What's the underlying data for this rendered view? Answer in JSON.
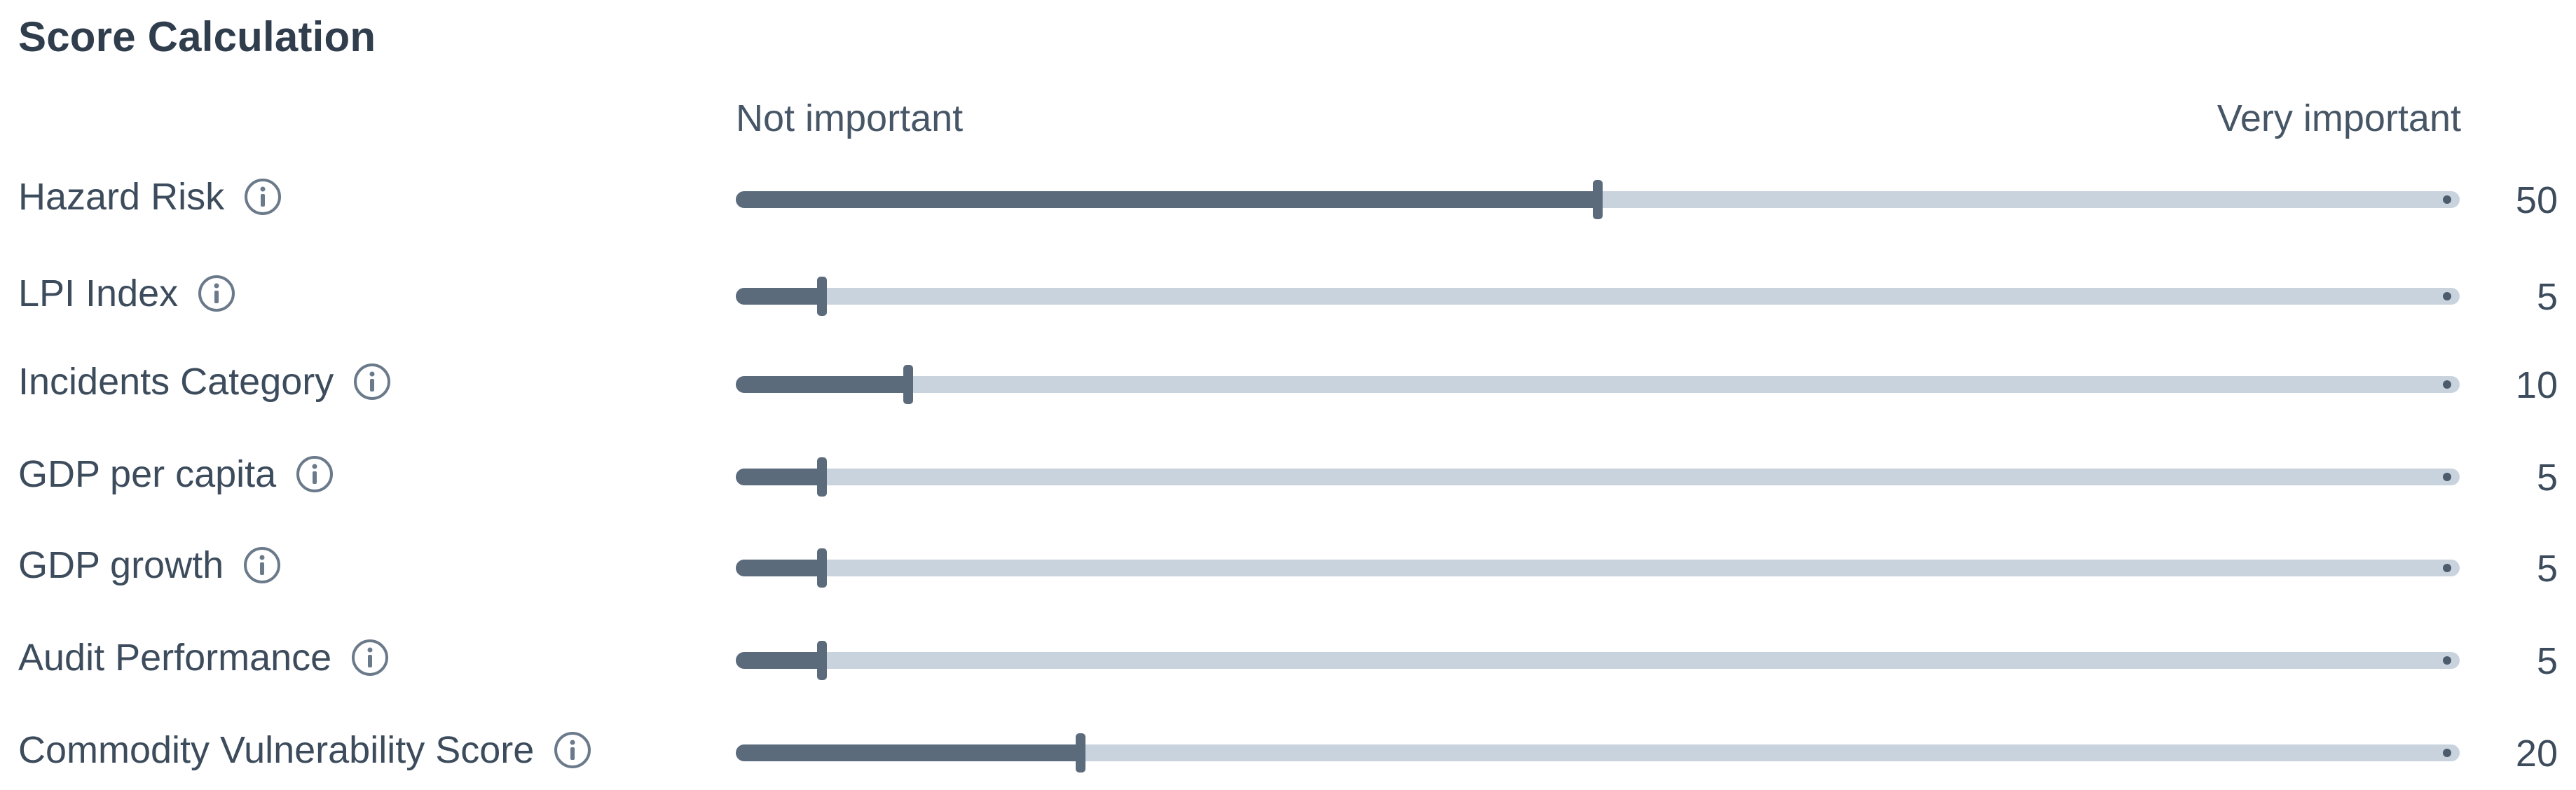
{
  "panel": {
    "title": "Score Calculation",
    "scale": {
      "min_label": "Not important",
      "max_label": "Very important",
      "max_value": 100
    }
  },
  "sliders": [
    {
      "label": "Hazard Risk",
      "value": 50,
      "value_text": "50",
      "icon": "info-icon"
    },
    {
      "label": "LPI Index",
      "value": 5,
      "value_text": "5",
      "icon": "info-icon"
    },
    {
      "label": "Incidents Category",
      "value": 10,
      "value_text": "10",
      "icon": "info-icon"
    },
    {
      "label": "GDP per capita",
      "value": 5,
      "value_text": "5",
      "icon": "info-icon"
    },
    {
      "label": "GDP growth",
      "value": 5,
      "value_text": "5",
      "icon": "info-icon"
    },
    {
      "label": "Audit Performance",
      "value": 5,
      "value_text": "5",
      "icon": "info-icon"
    },
    {
      "label": "Commodity Vulnerability Score",
      "value": 20,
      "value_text": "20",
      "icon": "info-icon"
    }
  ],
  "colors": {
    "track": "#c9d3de",
    "fill": "#5b6b7c",
    "text": "#3d4c5c",
    "icon": "#6b7a8a"
  }
}
